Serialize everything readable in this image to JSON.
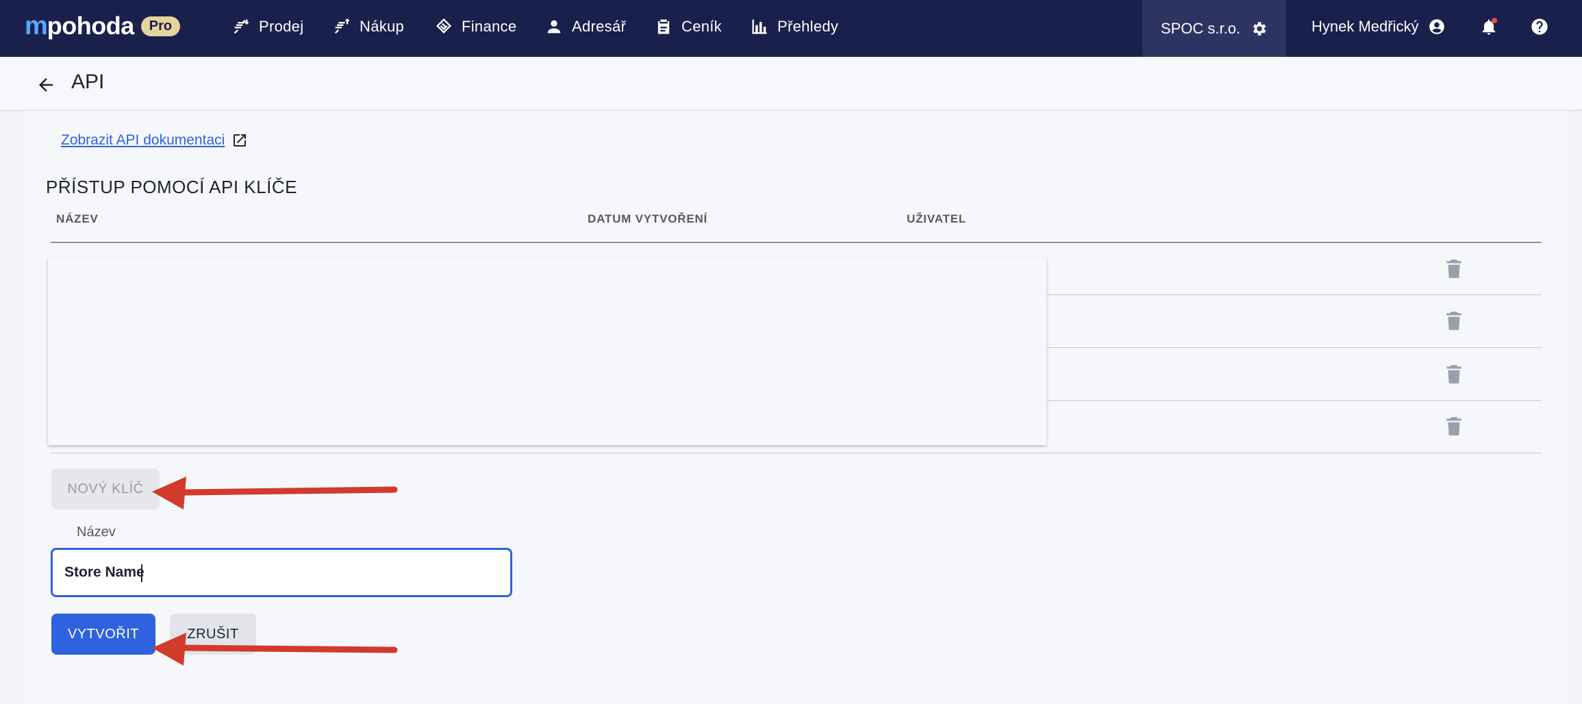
{
  "topbar": {
    "logo_mark": "m",
    "logo_text": "pohoda",
    "logo_badge": "Pro",
    "nav": [
      {
        "label": "Prodej",
        "icon": "sales-icon"
      },
      {
        "label": "Nákup",
        "icon": "purchase-icon"
      },
      {
        "label": "Finance",
        "icon": "finance-icon"
      },
      {
        "label": "Adresář",
        "icon": "person-icon"
      },
      {
        "label": "Ceník",
        "icon": "clipboard-icon"
      },
      {
        "label": "Přehledy",
        "icon": "bar-chart-icon"
      }
    ],
    "company": "SPOC s.r.o.",
    "user": "Hynek Medřický"
  },
  "subheader": {
    "title": "API"
  },
  "content": {
    "doc_link": "Zobrazit API dokumentaci",
    "section_title": "PŘÍSTUP POMOCÍ API KLÍČE",
    "columns": [
      "NÁZEV",
      "DATUM VYTVOŘENÍ",
      "UŽIVATEL"
    ],
    "rows": [
      {
        "name": "",
        "created": "",
        "user": ""
      },
      {
        "name": "",
        "created": "",
        "user": ""
      },
      {
        "name": "",
        "created": "",
        "user": ""
      },
      {
        "name": "",
        "created": "",
        "user": ""
      }
    ],
    "new_key_button": "NOVÝ KLÍČ",
    "name_label": "Název",
    "name_value": "Store Name",
    "create_button": "VYTVOŘIT",
    "cancel_button": "ZRUŠIT"
  },
  "colors": {
    "nav_bg": "#19204b",
    "primary": "#2f62e0",
    "annotation_arrow": "#d23a2b"
  }
}
